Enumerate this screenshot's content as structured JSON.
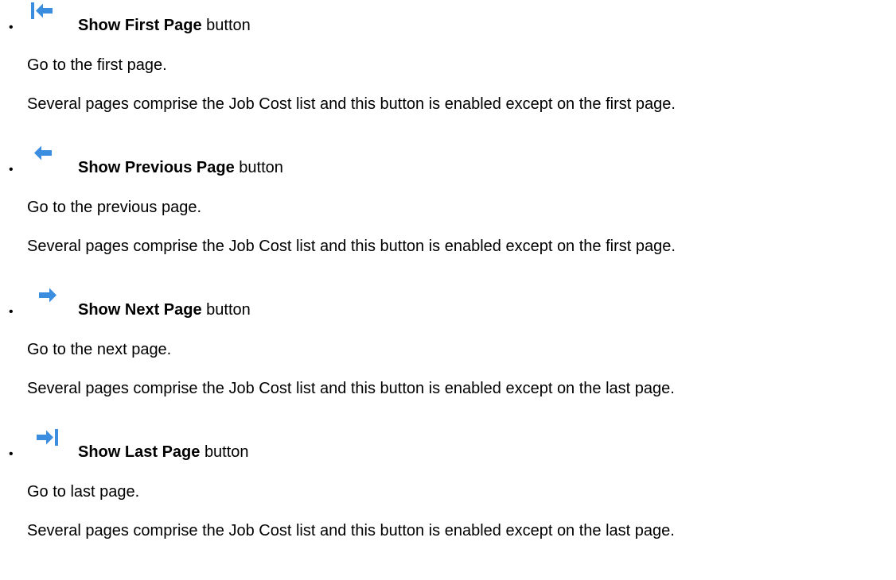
{
  "items": [
    {
      "icon": "first-page-arrow-icon",
      "name": "Show First Page",
      "suffix": "button",
      "description": "Go to the first page.",
      "note": "Several pages comprise the Job Cost list and this button is enabled except on the first page."
    },
    {
      "icon": "previous-page-arrow-icon",
      "name": "Show Previous Page",
      "suffix": "button",
      "description": "Go to the previous page.",
      "note": "Several pages comprise the Job Cost list and this button is enabled except on the first page."
    },
    {
      "icon": "next-page-arrow-icon",
      "name": "Show Next Page",
      "suffix": "button",
      "description": "Go to the next page.",
      "note": "Several pages comprise the Job Cost list and this button is enabled except on the last page."
    },
    {
      "icon": "last-page-arrow-icon",
      "name": "Show Last Page",
      "suffix": "button",
      "description": "Go to last page.",
      "note": "Several pages comprise the Job Cost list and this button is enabled except on the last page."
    }
  ],
  "bullet": "•",
  "colors": {
    "icon_blue": "#3b8de0",
    "text": "#000000",
    "background": "#ffffff"
  }
}
